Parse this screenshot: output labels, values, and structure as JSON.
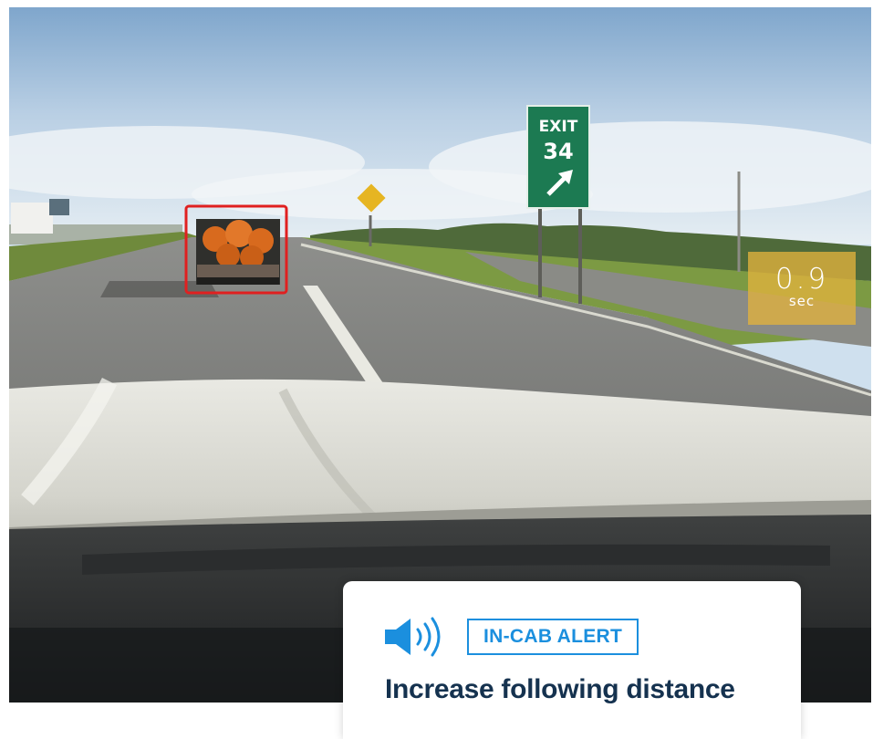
{
  "scene": {
    "exit_sign": {
      "line1": "EXIT",
      "line2": "34",
      "arrow": "arrow-up-right-icon"
    },
    "detection_box_color": "#e02020"
  },
  "following_timer": {
    "value": "0.9",
    "unit": "sec",
    "color": "#e2b23e"
  },
  "alert": {
    "icon": "speaker-volume-icon",
    "badge": "IN-CAB ALERT",
    "message": "Increase following distance",
    "accent_color": "#1b8fde",
    "text_color": "#15324f"
  }
}
